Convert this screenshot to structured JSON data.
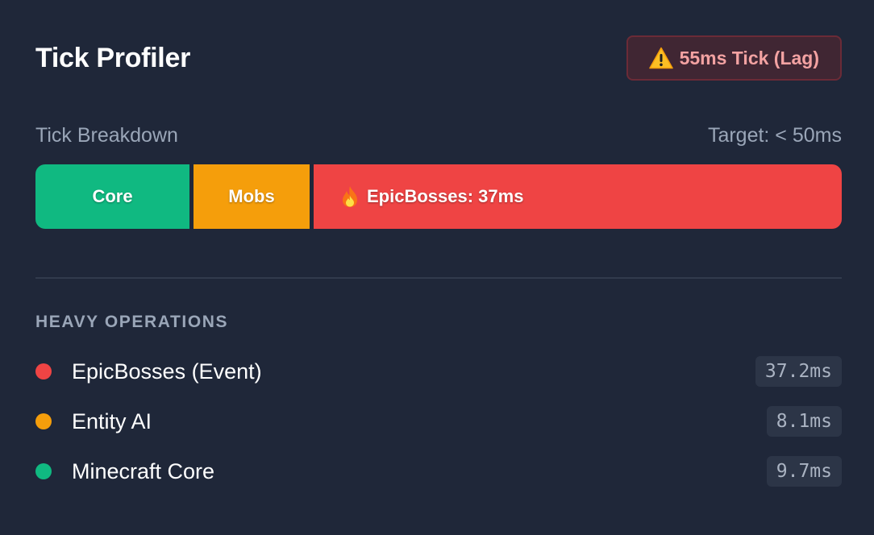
{
  "header": {
    "title": "Tick Profiler",
    "badge": {
      "icon": "warning-icon",
      "label": "55ms Tick (Lag)"
    }
  },
  "breakdown": {
    "label": "Tick Breakdown",
    "target": "Target: < 50ms",
    "segments": [
      {
        "label": "Core",
        "color": "#10b981"
      },
      {
        "label": "Mobs",
        "color": "#f59e0b"
      },
      {
        "label": "EpicBosses: 37ms",
        "icon": "flame-icon",
        "color": "#ef4444"
      }
    ]
  },
  "heavy_operations": {
    "title": "HEAVY OPERATIONS",
    "items": [
      {
        "name": "EpicBosses (Event)",
        "time": "37.2ms",
        "color": "#ef4444"
      },
      {
        "name": "Entity AI",
        "time": "8.1ms",
        "color": "#f59e0b"
      },
      {
        "name": "Minecraft Core",
        "time": "9.7ms",
        "color": "#10b981"
      }
    ]
  },
  "colors": {
    "background": "#1f2739",
    "badge_text": "#f3a2a2",
    "muted_text": "#9aa6b8"
  }
}
